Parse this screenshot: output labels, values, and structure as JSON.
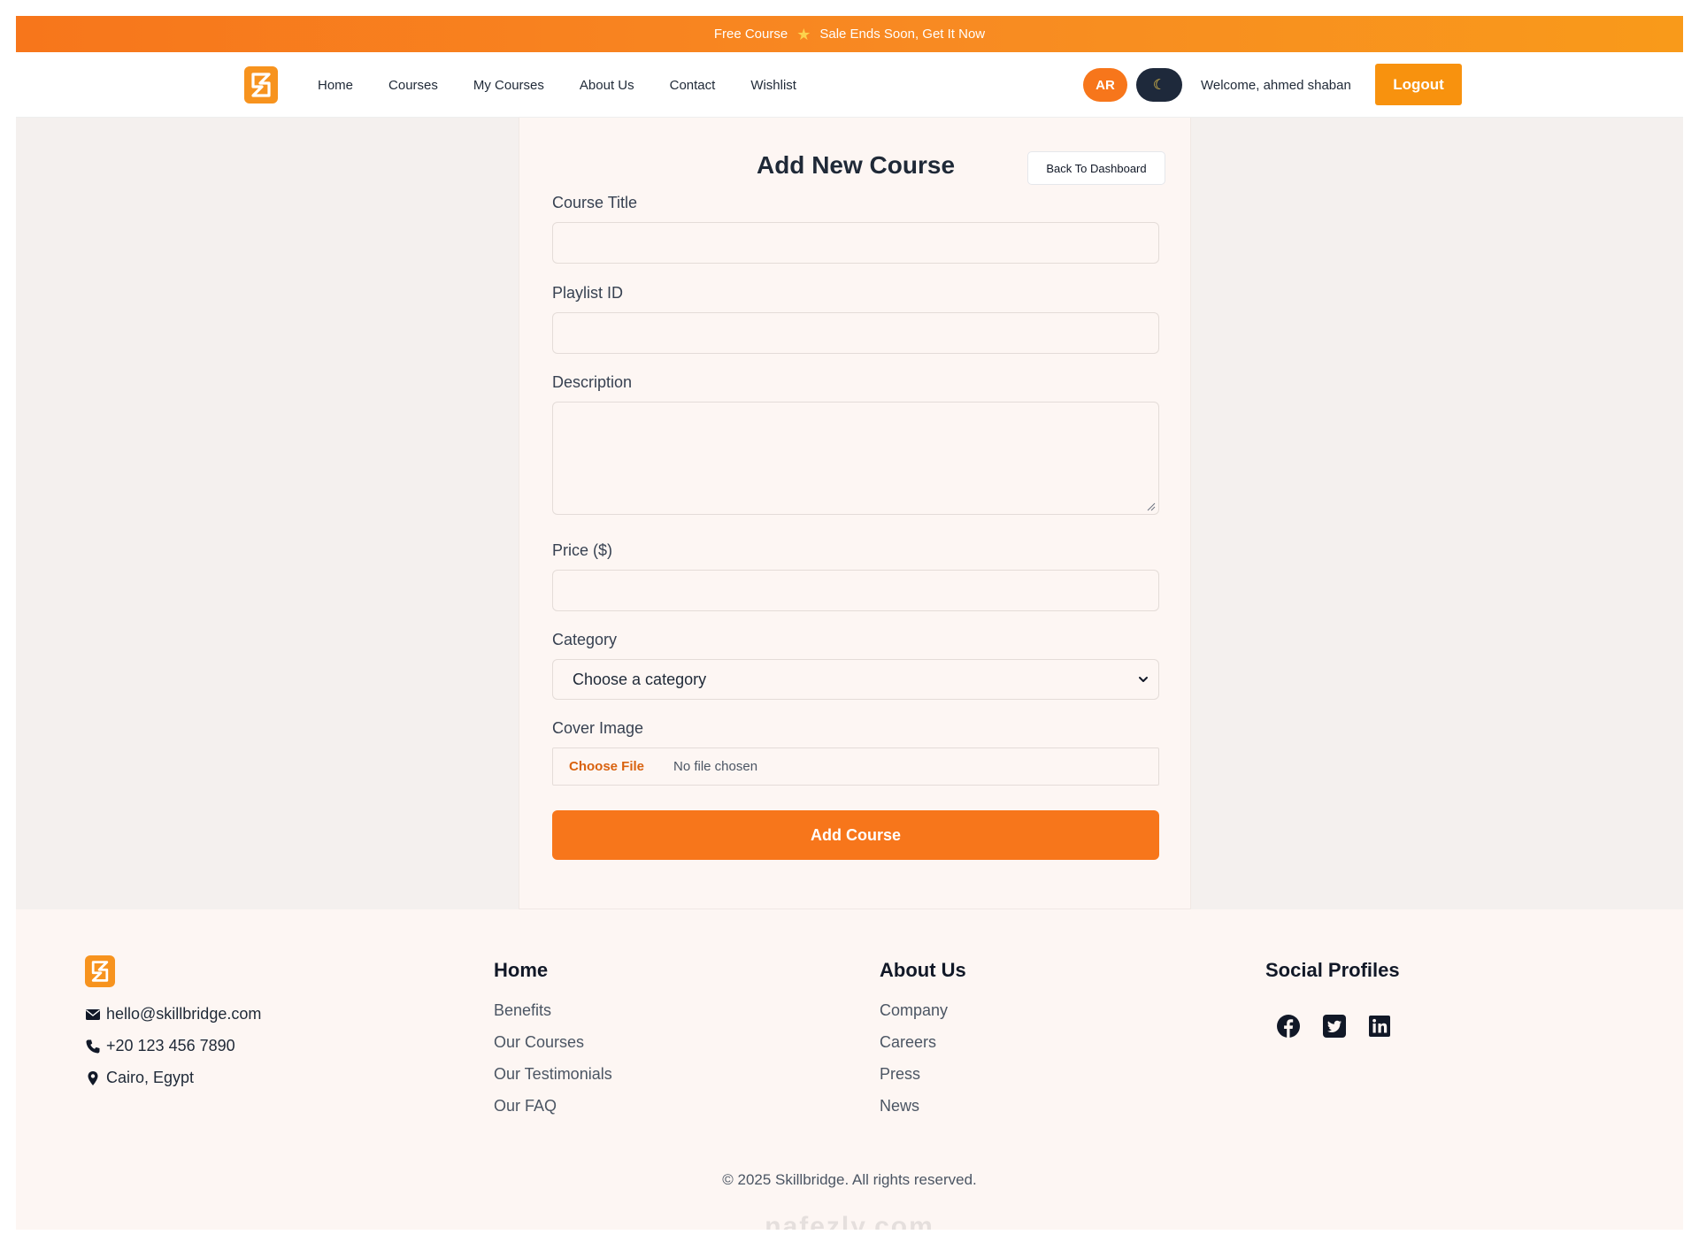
{
  "promo": {
    "left_text": "Free Course",
    "right_text": "Sale Ends Soon, Get It Now",
    "icon": "star-icon"
  },
  "navbar": {
    "logo_icon": "skillbridge-logo",
    "links": [
      "Home",
      "Courses",
      "My Courses",
      "About Us",
      "Contact",
      "Wishlist"
    ],
    "lang_label": "AR",
    "theme_icon": "moon-icon",
    "welcome": "Welcome, ahmed shaban",
    "logout_label": "Logout"
  },
  "form": {
    "title": "Add New Course",
    "back_label": "Back To Dashboard",
    "fields": {
      "course_title": {
        "label": "Course Title",
        "value": ""
      },
      "playlist_id": {
        "label": "Playlist ID",
        "value": ""
      },
      "description": {
        "label": "Description",
        "value": ""
      },
      "price": {
        "label": "Price ($)",
        "value": ""
      },
      "category": {
        "label": "Category",
        "selected": "Choose a category"
      },
      "cover_image": {
        "label": "Cover Image",
        "button": "Choose File",
        "status": "No file chosen"
      }
    },
    "submit_label": "Add Course"
  },
  "footer": {
    "email": "hello@skillbridge.com",
    "phone": "+20 123 456 7890",
    "location": "Cairo, Egypt",
    "col_home": {
      "heading": "Home",
      "links": [
        "Benefits",
        "Our Courses",
        "Our Testimonials",
        "Our FAQ"
      ]
    },
    "col_about": {
      "heading": "About Us",
      "links": [
        "Company",
        "Careers",
        "Press",
        "News"
      ]
    },
    "col_social": {
      "heading": "Social Profiles",
      "icons": [
        "facebook-icon",
        "twitter-icon",
        "linkedin-icon"
      ]
    },
    "copyright": "© 2025 Skillbridge. All rights reserved.",
    "watermark": "nafezly.com"
  },
  "colors": {
    "accent": "#f7761b",
    "accent_light": "#f8920e",
    "dark": "#1e293b",
    "page_bg": "#f4f0ee",
    "card_bg": "#fdf6f3"
  }
}
